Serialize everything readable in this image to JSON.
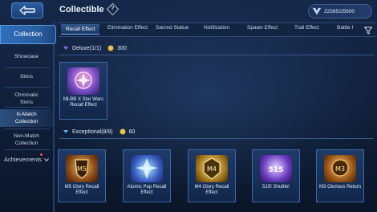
{
  "header": {
    "title": "Collectible",
    "info_glyph": "?",
    "currency_value": "22565/25600"
  },
  "tabs": [
    {
      "label": "Recall Effect",
      "active": true
    },
    {
      "label": "Elimination Effect"
    },
    {
      "label": "Sacred Statue"
    },
    {
      "label": "Notification"
    },
    {
      "label": "Spawn Effect"
    },
    {
      "label": "Trail Effect"
    },
    {
      "label": "Battle I"
    }
  ],
  "sidebar": {
    "main_label": "Collection",
    "items": [
      {
        "label": "Showcase"
      },
      {
        "label": "Skins"
      },
      {
        "label": "Chromatic Skins"
      },
      {
        "label": "In-Match Collection",
        "active": true
      },
      {
        "label": "Non-Match Collection"
      }
    ],
    "achievements_label": "Achievements"
  },
  "sections": [
    {
      "label": "Deluxe(1/1)",
      "points": "300",
      "items": [
        {
          "name": "MLBB X Star Wars Recall Effect",
          "color_a": "#5b3aa8",
          "color_b": "#e07aa3",
          "icon": "star-wars-medal-icon"
        }
      ]
    },
    {
      "label": "Exceptional(8/8)",
      "points": "60",
      "items": [
        {
          "name": "M5 Glory Recall Effect",
          "color_a": "#6a3a1a",
          "color_b": "#f0c66a",
          "icon": "m5-crest-icon"
        },
        {
          "name": "Atomic Pop Recall Effect",
          "color_a": "#2f4fb0",
          "color_b": "#8fe0ff",
          "icon": "atomic-pop-icon"
        },
        {
          "name": "M4 Glory Recall Effect",
          "color_a": "#7a5a1a",
          "color_b": "#ffe08a",
          "icon": "m4-crest-icon"
        },
        {
          "name": "515! Shuttle!",
          "color_a": "#5a2aa0",
          "color_b": "#c8a8ff",
          "icon": "shuttle-515-icon"
        },
        {
          "name": "M3 Glorious Return",
          "color_a": "#6a3a10",
          "color_b": "#ffc060",
          "icon": "m3-crest-icon"
        }
      ]
    }
  ],
  "colors": {
    "accent": "#73b0ff",
    "gold": "#e8c35a"
  }
}
